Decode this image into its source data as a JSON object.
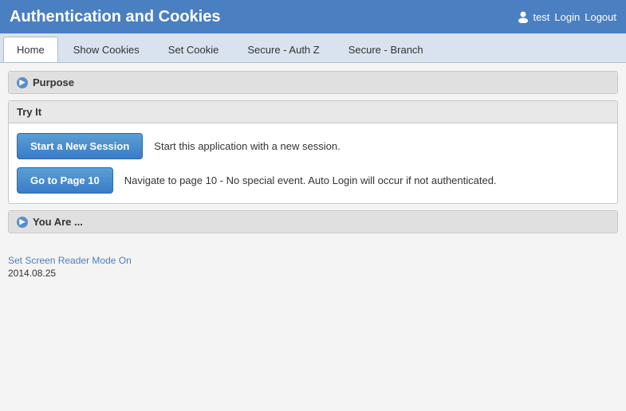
{
  "header": {
    "title": "Authentication and Cookies",
    "user": {
      "icon": "user-icon",
      "name": "test",
      "login_label": "Login",
      "logout_label": "Logout"
    }
  },
  "nav": {
    "tabs": [
      {
        "id": "home",
        "label": "Home",
        "active": true
      },
      {
        "id": "show-cookies",
        "label": "Show Cookies",
        "active": false
      },
      {
        "id": "set-cookie",
        "label": "Set Cookie",
        "active": false
      },
      {
        "id": "secure-authz",
        "label": "Secure - Auth Z",
        "active": false
      },
      {
        "id": "secure-branch",
        "label": "Secure - Branch",
        "active": false
      }
    ]
  },
  "sections": {
    "purpose": {
      "label": "Purpose"
    },
    "try_it": {
      "label": "Try It",
      "rows": [
        {
          "button_label": "Start a New Session",
          "description": "Start this application with a new session."
        },
        {
          "button_label": "Go to Page 10",
          "description": "Navigate to page 10 - No special event. Auto Login will occur if not authenticated."
        }
      ]
    },
    "you_are": {
      "label": "You Are ..."
    }
  },
  "footer": {
    "screen_reader_link": "Set Screen Reader Mode On",
    "date": "2014.08.25"
  }
}
